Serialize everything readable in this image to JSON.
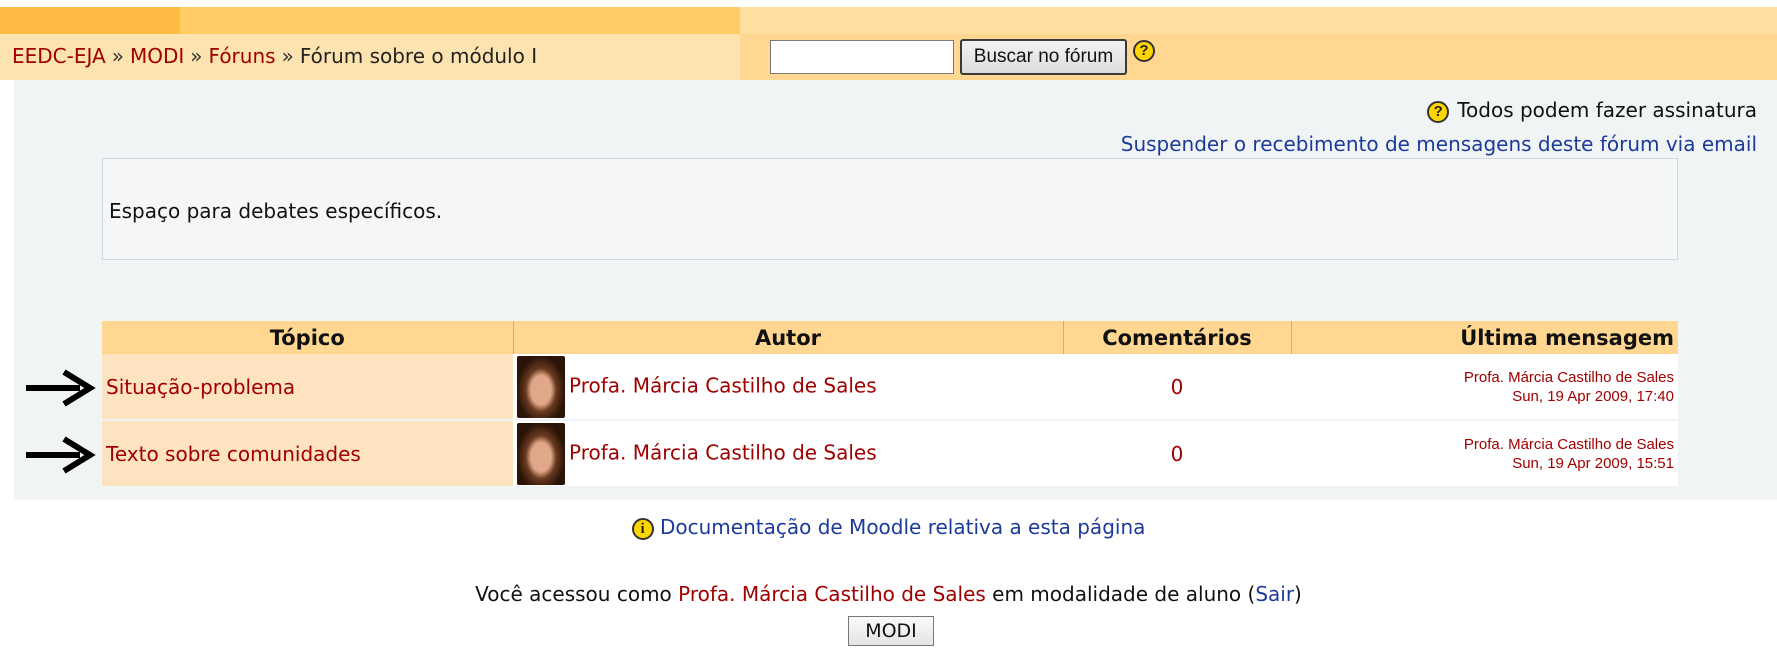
{
  "breadcrumb": {
    "items": [
      {
        "label": "EEDC-EJA"
      },
      {
        "label": "MODI"
      },
      {
        "label": "Fóruns"
      }
    ],
    "separator": "»",
    "current": "Fórum sobre o módulo I"
  },
  "search": {
    "value": "",
    "button_label": "Buscar no fórum",
    "help_icon": "?"
  },
  "subscription": {
    "help_icon": "?",
    "mode_text": "Todos podem fazer assinatura",
    "unsubscribe_link": "Suspender o recebimento de mensagens deste fórum via email"
  },
  "intro": {
    "text": "Espaço para debates específicos."
  },
  "table": {
    "headers": {
      "topic": "Tópico",
      "author": "Autor",
      "comments": "Comentários",
      "last_post": "Última mensagem"
    },
    "rows": [
      {
        "topic": "Situação-problema",
        "author": "Profa. Márcia Castilho de Sales",
        "comments": "0",
        "last_author": "Profa. Márcia Castilho de Sales",
        "last_date": "Sun, 19 Apr 2009, 17:40"
      },
      {
        "topic": "Texto sobre comunidades",
        "author": "Profa. Márcia Castilho de Sales",
        "comments": "0",
        "last_author": "Profa. Márcia Castilho de Sales",
        "last_date": "Sun, 19 Apr 2009, 15:51"
      }
    ]
  },
  "footer": {
    "info_icon": "i",
    "doc_link": "Documentação de Moodle relativa a esta página",
    "login_prefix": "Você acessou como",
    "login_user": "Profa. Márcia Castilho de Sales",
    "login_middle": "em modalidade de aluno (",
    "logout_link": "Sair",
    "login_suffix": ")",
    "home_button": "MODI"
  },
  "colors": {
    "link_red": "#a00000",
    "link_blue": "#1c3a9a",
    "header_orange": "#ffd791"
  }
}
